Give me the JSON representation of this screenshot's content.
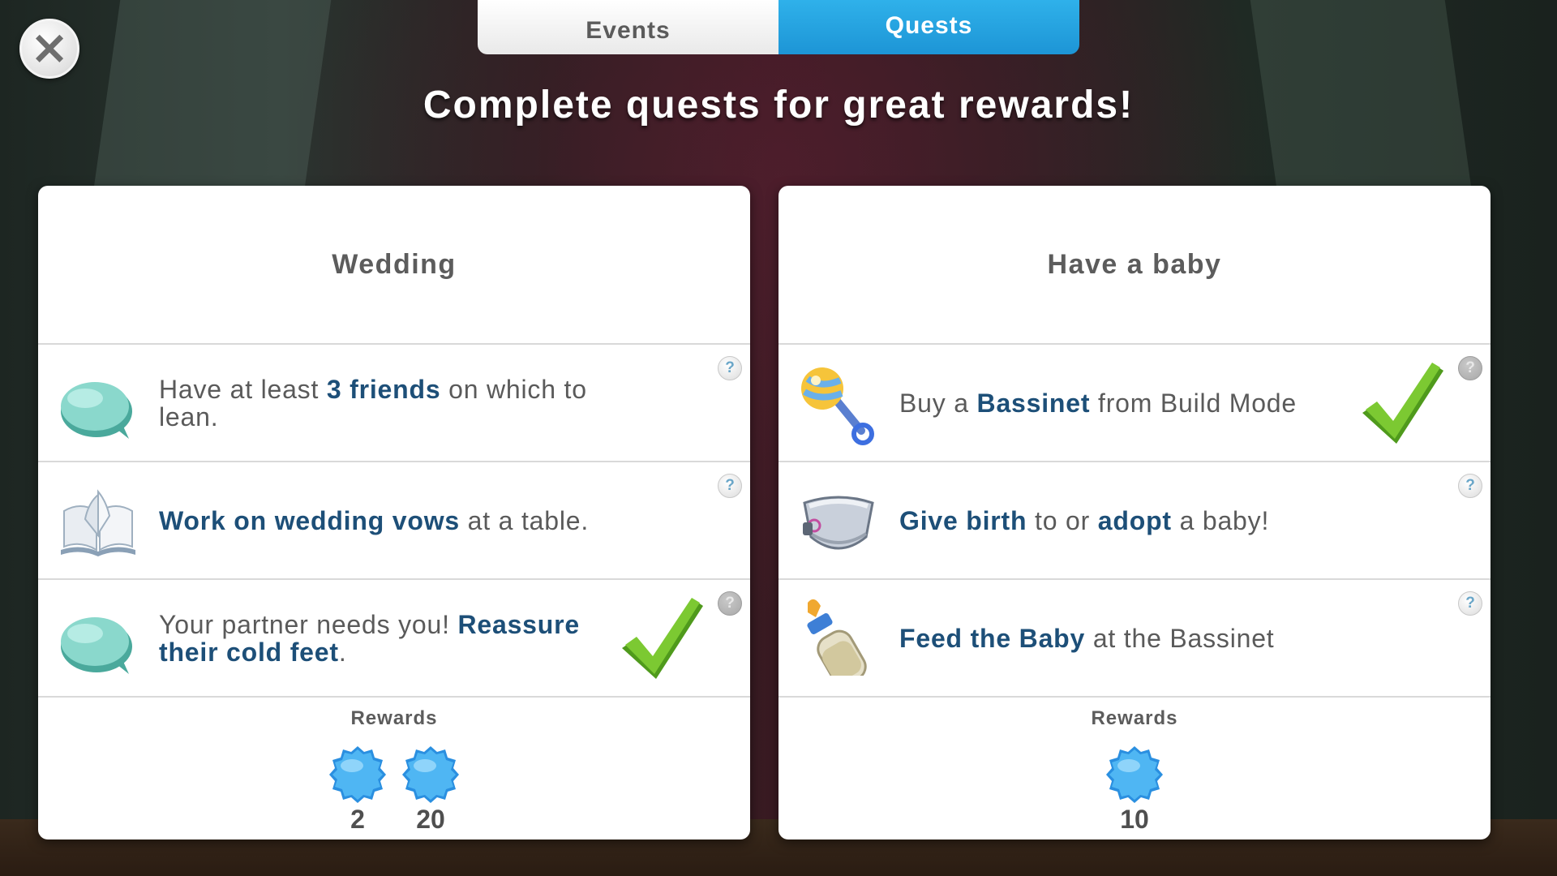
{
  "tabs": {
    "events": "Events",
    "quests": "Quests",
    "active": "Quests"
  },
  "headline": "Complete quests for great rewards!",
  "quests": [
    {
      "title": "Wedding",
      "tasks": [
        {
          "icon": "speech-bubble-icon",
          "parts": [
            {
              "t": "Have at least "
            },
            {
              "t": "3 friends",
              "hl": true
            },
            {
              "t": " on which to lean."
            }
          ],
          "completed": false
        },
        {
          "icon": "open-book-icon",
          "parts": [
            {
              "t": "Work on wedding vows",
              "hl": true
            },
            {
              "t": " at a table."
            }
          ],
          "completed": false
        },
        {
          "icon": "speech-bubble-icon",
          "parts": [
            {
              "t": "Your partner needs you! "
            },
            {
              "t": "Reassure their cold feet",
              "hl": true
            },
            {
              "t": "."
            }
          ],
          "completed": true
        }
      ],
      "rewards_label": "Rewards",
      "rewards": [
        {
          "icon": "blue-seal-icon",
          "value": "2"
        },
        {
          "icon": "blue-seal-icon",
          "value": "20"
        }
      ]
    },
    {
      "title": "Have a baby",
      "tasks": [
        {
          "icon": "rattle-icon",
          "parts": [
            {
              "t": "Buy a "
            },
            {
              "t": "Bassinet",
              "hl": true
            },
            {
              "t": " from Build Mode"
            }
          ],
          "completed": true
        },
        {
          "icon": "diaper-icon",
          "parts": [
            {
              "t": "Give birth",
              "hl": true
            },
            {
              "t": " to or "
            },
            {
              "t": "adopt",
              "hl": true
            },
            {
              "t": " a baby!"
            }
          ],
          "completed": false
        },
        {
          "icon": "baby-bottle-icon",
          "parts": [
            {
              "t": "Feed the Baby",
              "hl": true
            },
            {
              "t": " at the Bassinet"
            }
          ],
          "completed": false
        }
      ],
      "rewards_label": "Rewards",
      "rewards": [
        {
          "icon": "blue-seal-icon",
          "value": "10"
        }
      ]
    }
  ],
  "colors": {
    "tab_active": "#1d95d6",
    "highlight_text": "#1d4f78",
    "check_green": "#6cc02a"
  },
  "help_glyph": "?",
  "close_glyph": "×"
}
